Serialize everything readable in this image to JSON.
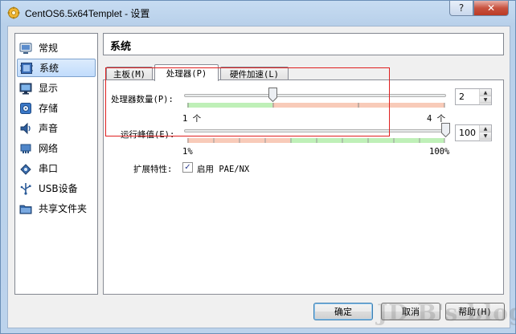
{
  "window": {
    "title": "CentOS6.5x64Templet - 设置",
    "help_label": "?",
    "close_label": "✕"
  },
  "sidebar": {
    "items": [
      {
        "label": "常规",
        "icon": "general-icon"
      },
      {
        "label": "系统",
        "icon": "system-icon",
        "selected": true
      },
      {
        "label": "显示",
        "icon": "display-icon"
      },
      {
        "label": "存储",
        "icon": "storage-icon"
      },
      {
        "label": "声音",
        "icon": "audio-icon"
      },
      {
        "label": "网络",
        "icon": "network-icon"
      },
      {
        "label": "串口",
        "icon": "serial-port-icon"
      },
      {
        "label": "USB设备",
        "icon": "usb-icon"
      },
      {
        "label": "共享文件夹",
        "icon": "shared-folder-icon"
      }
    ]
  },
  "page": {
    "title": "系统"
  },
  "tabs": [
    {
      "label": "主板(M)"
    },
    {
      "label": "处理器(P)",
      "active": true
    },
    {
      "label": "硬件加速(L)"
    }
  ],
  "processor": {
    "cpu_count_label": "处理器数量(P):",
    "cpu_count_value": "2",
    "cpu_min_label": "1 个",
    "cpu_max_label": "4 个",
    "cpu_min": 1,
    "cpu_max": 4,
    "cap_label": "运行峰值(E):",
    "cap_value": "100",
    "cap_min_label": "1%",
    "cap_max_label": "100%",
    "extended_label": "扩展特性:",
    "pae_label": "启用 PAE/NX",
    "pae_checked": true,
    "pae_check_glyph": "✓"
  },
  "buttons": {
    "ok": "确定",
    "cancel": "取消",
    "help": "帮助(H)"
  },
  "watermark": "JD B's blog",
  "colors": {
    "slider_good": "#bff0b8",
    "slider_bad": "#f8cbb9",
    "annotation": "#e02020"
  }
}
